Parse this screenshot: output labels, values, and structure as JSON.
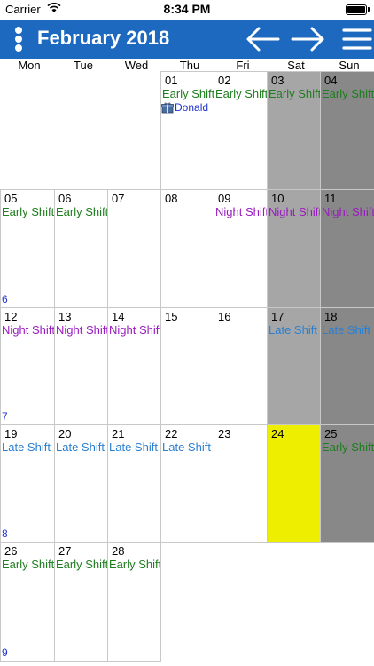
{
  "status_bar": {
    "carrier": "Carrier",
    "time": "8:34 PM"
  },
  "header": {
    "title": "February 2018"
  },
  "weekdays": [
    "Mon",
    "Tue",
    "Wed",
    "Thu",
    "Fri",
    "Sat",
    "Sun"
  ],
  "days": [
    {
      "day": "01",
      "shift": "Early Shift",
      "shift_type": "early",
      "event": "Donald"
    },
    {
      "day": "02",
      "shift": "Early Shift",
      "shift_type": "early"
    },
    {
      "day": "03",
      "shift": "Early Shift",
      "shift_type": "early"
    },
    {
      "day": "04",
      "shift": "Early Shift",
      "shift_type": "early"
    },
    {
      "day": "05",
      "shift": "Early Shift",
      "shift_type": "early",
      "week": "6"
    },
    {
      "day": "06",
      "shift": "Early Shift",
      "shift_type": "early"
    },
    {
      "day": "07"
    },
    {
      "day": "08"
    },
    {
      "day": "09",
      "shift": "Night Shift",
      "shift_type": "night"
    },
    {
      "day": "10",
      "shift": "Night Shift",
      "shift_type": "night"
    },
    {
      "day": "11",
      "shift": "Night Shift",
      "shift_type": "night"
    },
    {
      "day": "12",
      "shift": "Night Shift",
      "shift_type": "night",
      "week": "7"
    },
    {
      "day": "13",
      "shift": "Night Shift",
      "shift_type": "night"
    },
    {
      "day": "14",
      "shift": "Night Shift",
      "shift_type": "night"
    },
    {
      "day": "15"
    },
    {
      "day": "16"
    },
    {
      "day": "17",
      "shift": "Late Shift",
      "shift_type": "late"
    },
    {
      "day": "18",
      "shift": "Late Shift",
      "shift_type": "late"
    },
    {
      "day": "19",
      "shift": "Late Shift",
      "shift_type": "late",
      "week": "8"
    },
    {
      "day": "20",
      "shift": "Late Shift",
      "shift_type": "late"
    },
    {
      "day": "21",
      "shift": "Late Shift",
      "shift_type": "late"
    },
    {
      "day": "22",
      "shift": "Late Shift",
      "shift_type": "late"
    },
    {
      "day": "23"
    },
    {
      "day": "24",
      "today": true
    },
    {
      "day": "25",
      "shift": "Early Shift",
      "shift_type": "early"
    },
    {
      "day": "26",
      "shift": "Early Shift",
      "shift_type": "early",
      "week": "9"
    },
    {
      "day": "27",
      "shift": "Early Shift",
      "shift_type": "early"
    },
    {
      "day": "28",
      "shift": "Early Shift",
      "shift_type": "early"
    }
  ],
  "first_weekday_index": 3,
  "colors": {
    "header_bg": "#1c69bf",
    "saturday_bg": "#a6a6a6",
    "sunday_bg": "#888888",
    "today_bg": "#eeee00",
    "early_shift": "#1e7d1e",
    "night_shift": "#9a1bbf",
    "late_shift": "#2a7fd1",
    "week_number": "#2233cc"
  },
  "icons": {
    "menu": "vertical-dots-icon",
    "prev": "arrow-left-icon",
    "next": "arrow-right-icon",
    "list": "hamburger-icon",
    "event": "gift-icon"
  }
}
